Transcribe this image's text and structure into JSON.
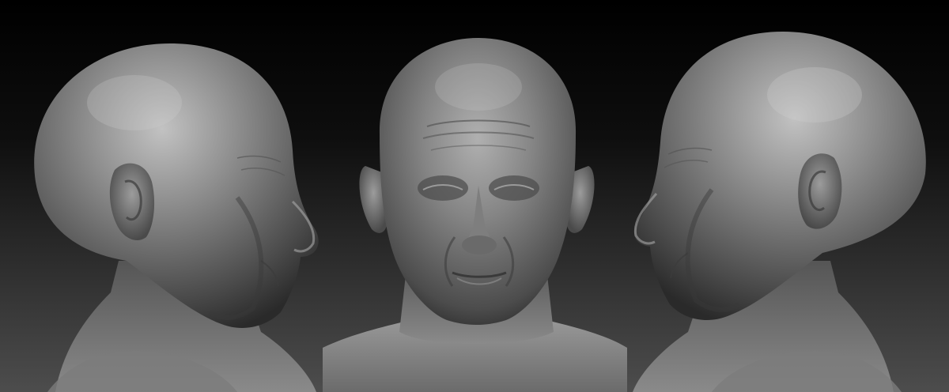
{
  "scene": {
    "views": [
      "side-left",
      "front",
      "side-right"
    ],
    "colors": {
      "background_top": "#000000",
      "background_bottom": "#4d4d4d",
      "clay_light": "#b8b8b8",
      "clay_mid": "#7a7a7a",
      "clay_dark": "#2e2e2e"
    }
  }
}
